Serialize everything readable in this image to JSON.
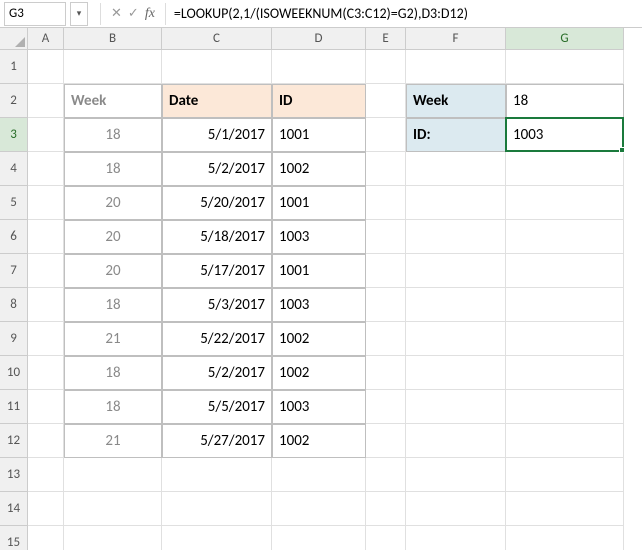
{
  "nameBox": "G3",
  "formula": "=LOOKUP(2,1/(ISOWEEKNUM(C3:C12)=G2),D3:D12)",
  "activeCol": "G",
  "activeRow": 3,
  "columns": [
    "A",
    "B",
    "C",
    "D",
    "E",
    "F",
    "G"
  ],
  "colClasses": [
    "w-A",
    "w-B",
    "w-C",
    "w-D",
    "w-E",
    "w-F",
    "w-G"
  ],
  "rowCount": 15,
  "tableHeaders": {
    "week": "Week",
    "date": "Date",
    "id": "ID"
  },
  "tableStartRow": 3,
  "tableRows": [
    {
      "week": "18",
      "date": "5/1/2017",
      "id": "1001"
    },
    {
      "week": "18",
      "date": "5/2/2017",
      "id": "1002"
    },
    {
      "week": "20",
      "date": "5/20/2017",
      "id": "1001"
    },
    {
      "week": "20",
      "date": "5/18/2017",
      "id": "1003"
    },
    {
      "week": "20",
      "date": "5/17/2017",
      "id": "1001"
    },
    {
      "week": "18",
      "date": "5/3/2017",
      "id": "1003"
    },
    {
      "week": "21",
      "date": "5/22/2017",
      "id": "1002"
    },
    {
      "week": "18",
      "date": "5/2/2017",
      "id": "1002"
    },
    {
      "week": "18",
      "date": "5/5/2017",
      "id": "1003"
    },
    {
      "week": "21",
      "date": "5/27/2017",
      "id": "1002"
    }
  ],
  "lookup": {
    "weekLabel": "Week",
    "weekValue": "18",
    "idLabel": "ID:",
    "idValue": "1003"
  },
  "chart_data": {
    "type": "table",
    "title": "",
    "columns": [
      "Week",
      "Date",
      "ID"
    ],
    "rows": [
      [
        18,
        "5/1/2017",
        1001
      ],
      [
        18,
        "5/2/2017",
        1002
      ],
      [
        20,
        "5/20/2017",
        1001
      ],
      [
        20,
        "5/18/2017",
        1003
      ],
      [
        20,
        "5/17/2017",
        1001
      ],
      [
        18,
        "5/3/2017",
        1003
      ],
      [
        21,
        "5/22/2017",
        1002
      ],
      [
        18,
        "5/2/2017",
        1002
      ],
      [
        18,
        "5/5/2017",
        1003
      ],
      [
        21,
        "5/27/2017",
        1002
      ]
    ],
    "lookup": {
      "Week": 18,
      "ID": 1003
    }
  }
}
